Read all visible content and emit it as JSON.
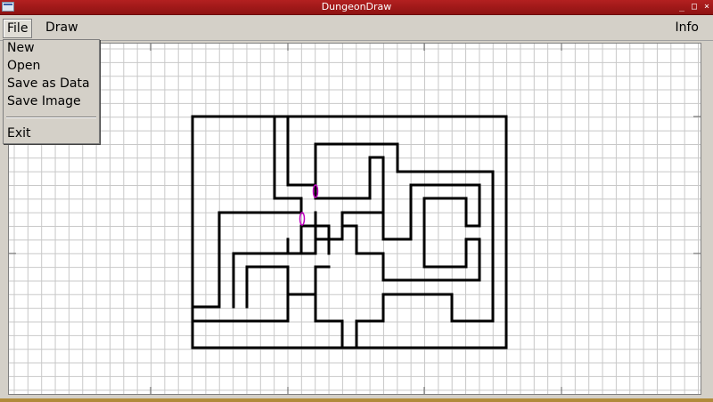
{
  "window": {
    "title": "DungeonDraw",
    "controls": {
      "minimize": "_",
      "maximize": "□",
      "close": "×"
    }
  },
  "menubar": {
    "file": "File",
    "draw": "Draw",
    "info": "Info"
  },
  "file_menu": {
    "items": [
      "New",
      "Open",
      "Save as Data",
      "Save Image"
    ],
    "exit": "Exit"
  },
  "colors": {
    "wall": "#000000",
    "door": "#c000c0",
    "grid_minor": "#c8c8c8",
    "grid_major": "#606060",
    "titlebar": "#a81b1b"
  }
}
